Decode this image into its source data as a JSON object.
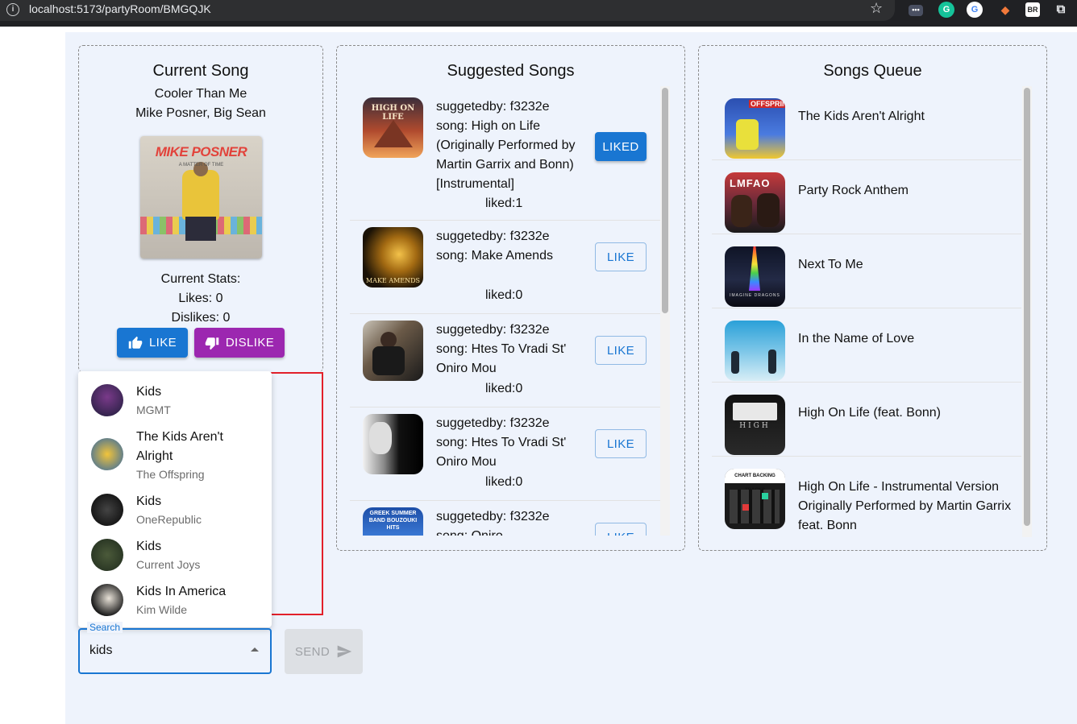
{
  "browser": {
    "url": "localhost:5173/partyRoom/BMGQJK"
  },
  "current_song": {
    "heading": "Current Song",
    "title": "Cooler Than Me",
    "artist": "Mike Posner, Big Sean",
    "album_art_text": "MIKE POSNER",
    "album_art_subtext": "A MATTER OF TIME",
    "stats_label": "Current Stats:",
    "likes_text": "Likes: 0",
    "dislikes_text": "Dislikes: 0",
    "like_button": "LIKE",
    "dislike_button": "DISLIKE"
  },
  "search": {
    "label": "Search",
    "value": "kids",
    "send_button": "SEND",
    "options": [
      {
        "title": "Kids",
        "artist": "MGMT"
      },
      {
        "title": "The Kids Aren't Alright",
        "artist": "The Offspring"
      },
      {
        "title": "Kids",
        "artist": "OneRepublic"
      },
      {
        "title": "Kids",
        "artist": "Current Joys"
      },
      {
        "title": "Kids In America",
        "artist": "Kim Wilde"
      }
    ]
  },
  "suggested": {
    "heading": "Suggested Songs",
    "items": [
      {
        "suggested_by": "suggetedby: f3232e",
        "song": "song: High on Life (Originally Performed by Martin Garrix and Bonn) [Instrumental]",
        "liked": "liked:1",
        "button": "LIKED",
        "art_text": "HIGH ON LIFE"
      },
      {
        "suggested_by": "suggetedby: f3232e",
        "song": "song: Make Amends",
        "liked": "liked:0",
        "button": "LIKE",
        "art_text": "MAKE AMENDS"
      },
      {
        "suggested_by": "suggetedby: f3232e",
        "song": "song: Htes To Vradi St' Oniro Mou",
        "liked": "liked:0",
        "button": "LIKE",
        "art_text": ""
      },
      {
        "suggested_by": "suggetedby: f3232e",
        "song": "song: Htes To Vradi St' Oniro Mou",
        "liked": "liked:0",
        "button": "LIKE",
        "art_text": ""
      },
      {
        "suggested_by": "suggetedby: f3232e",
        "song": "song: Oniro",
        "liked": "",
        "button": "LIKE",
        "art_text": "GREEK SUMMER BAND BOUZOUKI HITS"
      }
    ]
  },
  "queue": {
    "heading": "Songs Queue",
    "items": [
      {
        "title": "The Kids Aren't Alright",
        "art_text": "OFFSPRING"
      },
      {
        "title": "Party Rock Anthem",
        "art_text": "LMFAO"
      },
      {
        "title": "Next To Me",
        "art_text": "IMAGINE DRAGONS"
      },
      {
        "title": "In the Name of Love",
        "art_text": ""
      },
      {
        "title": "High On Life (feat. Bonn)",
        "art_text": "HIGH"
      },
      {
        "title": "High On Life - Instrumental Version Originally Performed by Martin Garrix feat. Bonn",
        "art_text": "CHART BACKING TRACKS"
      }
    ]
  },
  "colors": {
    "primary": "#1976d2",
    "secondary": "#9c27b0",
    "page_bg": "#eef3fc",
    "highlight_border": "#e2202a"
  }
}
